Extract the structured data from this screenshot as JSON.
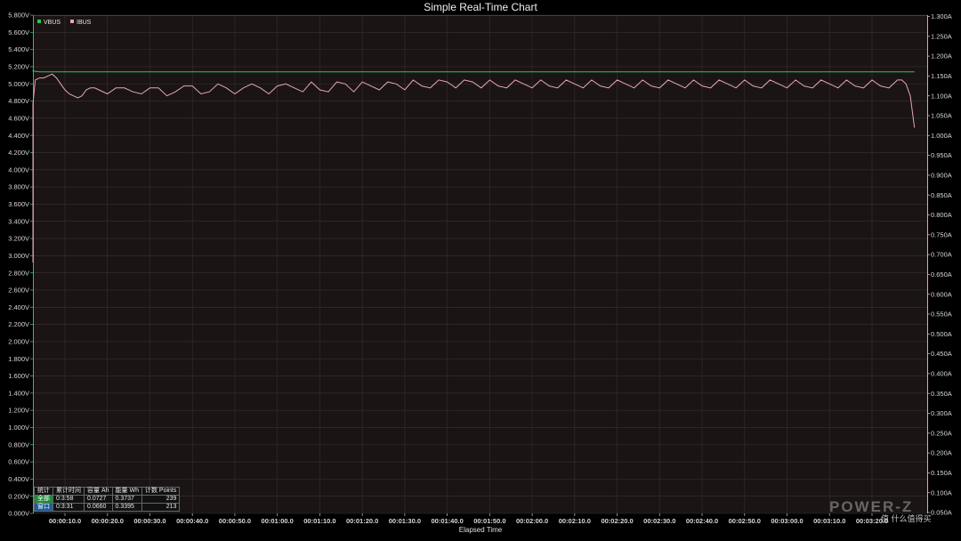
{
  "chart_data": {
    "type": "line",
    "title": "Simple Real-Time Chart",
    "xlabel": "Elapsed Time",
    "x_ticks": [
      "00:00:10.0",
      "00:00:20.0",
      "00:00:30.0",
      "00:00:40.0",
      "00:00:50.0",
      "00:01:00.0",
      "00:01:10.0",
      "00:01:20.0",
      "00:01:30.0",
      "00:01:40.0",
      "00:01:50.0",
      "00:02:00.0",
      "00:02:10.0",
      "00:02:20.0",
      "00:02:30.0",
      "00:02:40.0",
      "00:02:50.0",
      "00:03:00.0",
      "00:03:10.0",
      "00:03:20.0"
    ],
    "xlim_seconds": [
      0,
      210
    ],
    "y_left": {
      "ylim": [
        0,
        5.8
      ],
      "ticks": [
        "0.000V",
        "0.200V",
        "0.400V",
        "0.600V",
        "0.800V",
        "1.000V",
        "1.200V",
        "1.400V",
        "1.600V",
        "1.800V",
        "2.000V",
        "2.200V",
        "2.400V",
        "2.600V",
        "2.800V",
        "3.000V",
        "3.200V",
        "3.400V",
        "3.600V",
        "3.800V",
        "4.000V",
        "4.200V",
        "4.400V",
        "4.600V",
        "4.800V",
        "5.000V",
        "5.200V",
        "5.400V",
        "5.600V",
        "5.800V"
      ]
    },
    "y_right": {
      "ylim": [
        0.65,
        1.3
      ],
      "ticks": [
        "0.050A",
        "0.100A",
        "0.150A",
        "0.200A",
        "0.250A",
        "0.300A",
        "0.350A",
        "0.400A",
        "0.450A",
        "0.500A",
        "0.550A",
        "0.600A",
        "0.650A",
        "0.700A",
        "0.750A",
        "0.800A",
        "0.850A",
        "0.900A",
        "0.950A",
        "1.000A",
        "1.050A",
        "1.100A",
        "1.150A",
        "1.200A",
        "1.250A",
        "1.300A"
      ]
    },
    "series": [
      {
        "name": "VBUS",
        "color": "#2ec35a",
        "axis": "left",
        "x": [
          0,
          2,
          4,
          210
        ],
        "y": [
          5.16,
          5.15,
          5.14,
          5.14
        ]
      },
      {
        "name": "IBUS",
        "color": "#e8a6b4",
        "axis": "right",
        "x": [
          0,
          1,
          2,
          3,
          4,
          5,
          6,
          7,
          8,
          9,
          10,
          11,
          12,
          13,
          14,
          15,
          16,
          17,
          18,
          20,
          22,
          24,
          26,
          28,
          30,
          32,
          34,
          36,
          38,
          40,
          42,
          44,
          46,
          48,
          50,
          52,
          54,
          56,
          58,
          60,
          62,
          64,
          66,
          68,
          70,
          72,
          74,
          76,
          78,
          80,
          82,
          84,
          86,
          88,
          90,
          92,
          94,
          96,
          98,
          100,
          102,
          104,
          106,
          108,
          110,
          112,
          114,
          116,
          118,
          120,
          122,
          124,
          126,
          128,
          130,
          132,
          134,
          136,
          138,
          140,
          142,
          144,
          146,
          148,
          150,
          152,
          154,
          156,
          158,
          160,
          162,
          164,
          166,
          168,
          170,
          172,
          174,
          176,
          178,
          180,
          182,
          184,
          186,
          188,
          190,
          192,
          194,
          196,
          198,
          200,
          202,
          204,
          206,
          207,
          208,
          209,
          210
        ],
        "y": [
          0.68,
          0.88,
          1.08,
          1.14,
          1.145,
          1.145,
          1.15,
          1.155,
          1.145,
          1.13,
          1.115,
          1.105,
          1.1,
          1.095,
          1.1,
          1.115,
          1.12,
          1.12,
          1.115,
          1.105,
          1.12,
          1.12,
          1.11,
          1.105,
          1.12,
          1.12,
          1.1,
          1.11,
          1.125,
          1.125,
          1.105,
          1.11,
          1.13,
          1.12,
          1.105,
          1.12,
          1.13,
          1.12,
          1.105,
          1.125,
          1.13,
          1.12,
          1.11,
          1.135,
          1.115,
          1.11,
          1.135,
          1.13,
          1.11,
          1.135,
          1.125,
          1.115,
          1.135,
          1.13,
          1.115,
          1.14,
          1.125,
          1.12,
          1.14,
          1.135,
          1.12,
          1.14,
          1.135,
          1.12,
          1.14,
          1.125,
          1.12,
          1.14,
          1.13,
          1.12,
          1.14,
          1.125,
          1.12,
          1.14,
          1.13,
          1.12,
          1.14,
          1.125,
          1.12,
          1.14,
          1.13,
          1.12,
          1.14,
          1.125,
          1.12,
          1.14,
          1.13,
          1.12,
          1.14,
          1.125,
          1.12,
          1.14,
          1.13,
          1.12,
          1.14,
          1.125,
          1.12,
          1.14,
          1.13,
          1.12,
          1.14,
          1.125,
          1.12,
          1.14,
          1.13,
          1.12,
          1.14,
          1.125,
          1.12,
          1.14,
          1.125,
          1.12,
          1.14,
          1.14,
          1.13,
          1.1,
          1.02
        ]
      }
    ],
    "grid": true,
    "legend": "top-left"
  },
  "colors": {
    "background": "#000000",
    "plot_background": "#1a1414",
    "grid": "#3a3030",
    "top_border": "#7a2a20",
    "vbus_axis": "#2ec35a",
    "ibus_axis": "#e8a6b4"
  },
  "stats": {
    "headers": [
      "统计",
      "累计时间",
      "容量 Ah",
      "能量 Wh",
      "计数 Points"
    ],
    "rows": [
      [
        "全部",
        "0:3:58",
        "0.0727",
        "0.3737",
        "239"
      ],
      [
        "窗口",
        "0:3:31",
        "0.0660",
        "0.3395",
        "213"
      ]
    ]
  },
  "watermark": {
    "brand": "POWER-Z",
    "site": "值 什么值得买"
  }
}
